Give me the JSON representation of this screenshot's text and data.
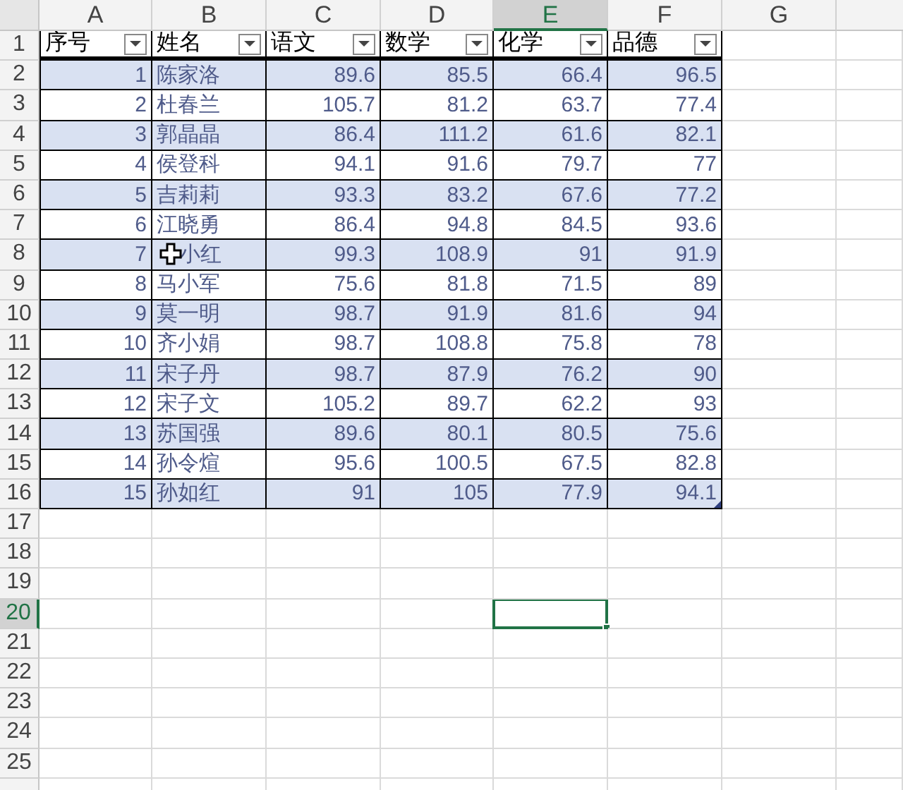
{
  "column_headers": [
    {
      "label": "A",
      "selected": false
    },
    {
      "label": "B",
      "selected": false
    },
    {
      "label": "C",
      "selected": false
    },
    {
      "label": "D",
      "selected": false
    },
    {
      "label": "E",
      "selected": true
    },
    {
      "label": "F",
      "selected": false
    },
    {
      "label": "G",
      "selected": false
    }
  ],
  "row_headers": [
    {
      "label": "1",
      "selected": false
    },
    {
      "label": "2",
      "selected": false
    },
    {
      "label": "3",
      "selected": false
    },
    {
      "label": "4",
      "selected": false
    },
    {
      "label": "5",
      "selected": false
    },
    {
      "label": "6",
      "selected": false
    },
    {
      "label": "7",
      "selected": false
    },
    {
      "label": "8",
      "selected": false
    },
    {
      "label": "9",
      "selected": false
    },
    {
      "label": "10",
      "selected": false
    },
    {
      "label": "11",
      "selected": false
    },
    {
      "label": "12",
      "selected": false
    },
    {
      "label": "13",
      "selected": false
    },
    {
      "label": "14",
      "selected": false
    },
    {
      "label": "15",
      "selected": false
    },
    {
      "label": "16",
      "selected": false
    },
    {
      "label": "17",
      "selected": false
    },
    {
      "label": "18",
      "selected": false
    },
    {
      "label": "19",
      "selected": false
    },
    {
      "label": "20",
      "selected": true
    },
    {
      "label": "21",
      "selected": false
    },
    {
      "label": "22",
      "selected": false
    },
    {
      "label": "23",
      "selected": false
    },
    {
      "label": "24",
      "selected": false
    },
    {
      "label": "25",
      "selected": false
    }
  ],
  "table": {
    "columns": [
      "序号",
      "姓名",
      "语文",
      "数学",
      "化学",
      "品德"
    ],
    "rows": [
      {
        "shaded": true,
        "cursor": false,
        "cells": [
          "1",
          "陈家洛",
          "89.6",
          "85.5",
          "66.4",
          "96.5"
        ]
      },
      {
        "shaded": false,
        "cursor": false,
        "cells": [
          "2",
          "杜春兰",
          "105.7",
          "81.2",
          "63.7",
          "77.4"
        ]
      },
      {
        "shaded": true,
        "cursor": false,
        "cells": [
          "3",
          "郭晶晶",
          "86.4",
          "111.2",
          "61.6",
          "82.1"
        ]
      },
      {
        "shaded": false,
        "cursor": false,
        "cells": [
          "4",
          "侯登科",
          "94.1",
          "91.6",
          "79.7",
          "77"
        ]
      },
      {
        "shaded": true,
        "cursor": false,
        "cells": [
          "5",
          "吉莉莉",
          "93.3",
          "83.2",
          "67.6",
          "77.2"
        ]
      },
      {
        "shaded": false,
        "cursor": false,
        "cells": [
          "6",
          "江晓勇",
          "86.4",
          "94.8",
          "84.5",
          "93.6"
        ]
      },
      {
        "shaded": true,
        "cursor": true,
        "cells": [
          "7",
          "小红",
          "99.3",
          "108.9",
          "91",
          "91.9"
        ]
      },
      {
        "shaded": false,
        "cursor": false,
        "cells": [
          "8",
          "马小军",
          "75.6",
          "81.8",
          "71.5",
          "89"
        ]
      },
      {
        "shaded": true,
        "cursor": false,
        "cells": [
          "9",
          "莫一明",
          "98.7",
          "91.9",
          "81.6",
          "94"
        ]
      },
      {
        "shaded": false,
        "cursor": false,
        "cells": [
          "10",
          "齐小娟",
          "98.7",
          "108.8",
          "75.8",
          "78"
        ]
      },
      {
        "shaded": true,
        "cursor": false,
        "cells": [
          "11",
          "宋子丹",
          "98.7",
          "87.9",
          "76.2",
          "90"
        ]
      },
      {
        "shaded": false,
        "cursor": false,
        "cells": [
          "12",
          "宋子文",
          "105.2",
          "89.7",
          "62.2",
          "93"
        ]
      },
      {
        "shaded": true,
        "cursor": false,
        "cells": [
          "13",
          "苏国强",
          "89.6",
          "80.1",
          "80.5",
          "75.6"
        ]
      },
      {
        "shaded": false,
        "cursor": false,
        "cells": [
          "14",
          "孙令煊",
          "95.6",
          "100.5",
          "67.5",
          "82.8"
        ]
      },
      {
        "shaded": true,
        "cursor": false,
        "cells": [
          "15",
          "孙如红",
          "91",
          "105",
          "77.9",
          "94.1"
        ]
      }
    ]
  }
}
